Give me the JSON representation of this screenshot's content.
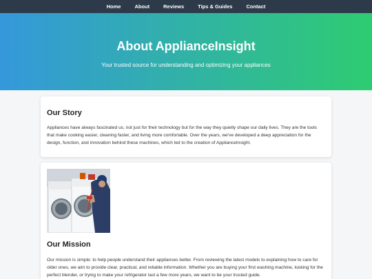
{
  "nav": {
    "items": [
      "Home",
      "About",
      "Reviews",
      "Tips & Guides",
      "Contact"
    ]
  },
  "hero": {
    "title": "About ApplianceInsight",
    "subtitle": "Your trusted source for understanding and optimizing your appliances"
  },
  "story": {
    "heading": "Our Story",
    "body": "Appliances have always fascinated us, not just for their technology but for the way they quietly shape our daily lives. They are the tools that make cooking easier, cleaning faster, and living more comfortable. Over the years, we've developed a deep appreciation for the design, function, and innovation behind these machines, which led to the creation of ApplianceInsight."
  },
  "mission": {
    "heading": "Our Mission",
    "body": "Our mission is simple: to help people understand their appliances better. From reviewing the latest models to explaining how to care for older ones, we aim to provide clear, practical, and reliable information. Whether you are buying your first washing machine, looking for the perfect blender, or trying to make your refrigerator last a few more years, we want to be your trusted guide."
  },
  "colors": {
    "nav_bg": "#2d3a4a",
    "gradient_start": "#3498db",
    "gradient_end": "#2ecc71",
    "page_bg": "#f4f6f8"
  }
}
